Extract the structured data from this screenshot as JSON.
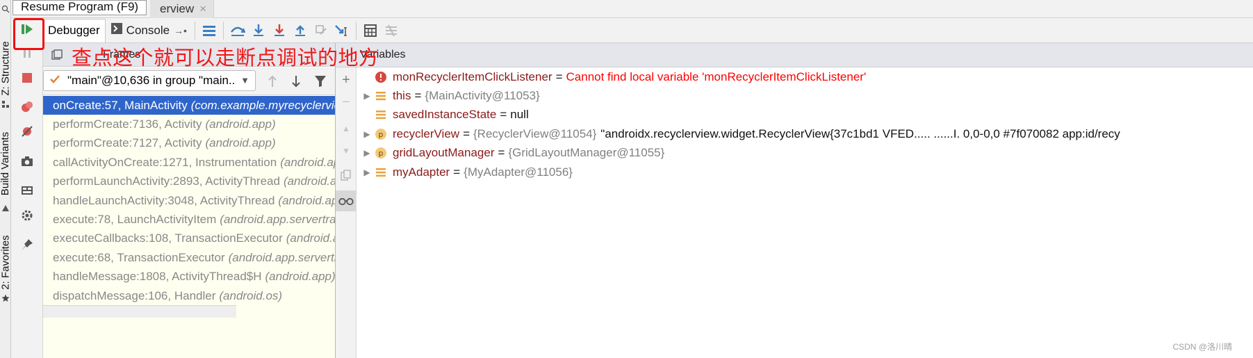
{
  "tooltip": "Resume Program (F9)",
  "editor_tab": {
    "label": "erview",
    "close": "×"
  },
  "side_tabs": {
    "structure": "Z: Structure",
    "build_variants": "Build Variants",
    "favorites": "2: Favorites"
  },
  "toolbar": {
    "debugger_tab": "Debugger",
    "console_tab": "Console"
  },
  "frames": {
    "title": "Frames",
    "thread": "\"main\"@10,636 in group \"main..",
    "rows": [
      {
        "method": "onCreate:57, MainActivity",
        "pkg": "(com.example.myrecyclervie",
        "selected": true
      },
      {
        "method": "performCreate:7136, Activity",
        "pkg": "(android.app)"
      },
      {
        "method": "performCreate:7127, Activity",
        "pkg": "(android.app)"
      },
      {
        "method": "callActivityOnCreate:1271, Instrumentation",
        "pkg": "(android.ap"
      },
      {
        "method": "performLaunchActivity:2893, ActivityThread",
        "pkg": "(android.ap"
      },
      {
        "method": "handleLaunchActivity:3048, ActivityThread",
        "pkg": "(android.ap"
      },
      {
        "method": "execute:78, LaunchActivityItem",
        "pkg": "(android.app.servertran"
      },
      {
        "method": "executeCallbacks:108, TransactionExecutor",
        "pkg": "(android.ap"
      },
      {
        "method": "execute:68, TransactionExecutor",
        "pkg": "(android.app.servertra"
      },
      {
        "method": "handleMessage:1808, ActivityThread$H",
        "pkg": "(android.app)"
      },
      {
        "method": "dispatchMessage:106, Handler",
        "pkg": "(android.os)"
      }
    ]
  },
  "annotation": "查点这个就可以走断点调试的地方",
  "variables": {
    "title": "Variables",
    "rows": [
      {
        "icon": "error-icon",
        "expandable": false,
        "name": "monRecyclerItemClickListener",
        "eq": "=",
        "value": "Cannot find local variable 'monRecyclerItemClickListener'",
        "value_style": "red"
      },
      {
        "icon": "field-icon",
        "expandable": true,
        "name": "this",
        "eq": "=",
        "value": "{MainActivity@11053}",
        "value_style": "gray"
      },
      {
        "icon": "field-icon",
        "expandable": false,
        "name": "savedInstanceState",
        "eq": "=",
        "value": "null",
        "value_style": "black"
      },
      {
        "icon": "param-icon",
        "expandable": true,
        "name": "recyclerView",
        "eq": "=",
        "value": "{RecyclerView@11054}",
        "value_style": "gray",
        "extra": "\"androidx.recyclerview.widget.RecyclerView{37c1bd1 VFED..... ......I. 0,0-0,0 #7f070082 app:id/recy"
      },
      {
        "icon": "param-icon",
        "expandable": true,
        "name": "gridLayoutManager",
        "eq": "=",
        "value": "{GridLayoutManager@11055}",
        "value_style": "gray"
      },
      {
        "icon": "field-icon",
        "expandable": true,
        "name": "myAdapter",
        "eq": "=",
        "value": "{MyAdapter@11056}",
        "value_style": "gray"
      }
    ]
  },
  "watermark": "CSDN @洛川晴",
  "colors": {
    "selection": "#2f65ca",
    "highlight": "#f20d0d",
    "frames_bg": "#fffff0",
    "var_name": "#8a1a19"
  }
}
